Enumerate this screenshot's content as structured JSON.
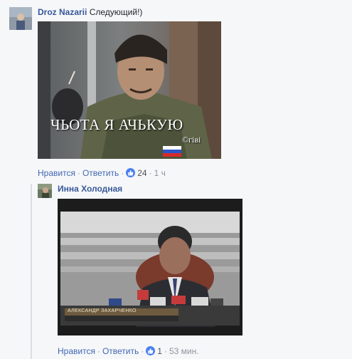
{
  "comment1": {
    "author": "Droz Nazarii",
    "text": "Следующий!)",
    "image_caption": "ЧЬОТА Я АЧЬКУЮ",
    "image_signature": "©гіві",
    "actions": {
      "like": "Нравится",
      "reply": "Ответить",
      "reactions_count": "24",
      "time": "1 ч"
    }
  },
  "comment2": {
    "author": "Инна Холодная",
    "image_tv_caption": "АЛЕКСАНДР ЗАХАРЧЕНКО",
    "actions": {
      "like": "Нравится",
      "reply": "Ответить",
      "reactions_count": "1",
      "time": "53 мин."
    }
  },
  "separator": "·",
  "colors": {
    "link": "#4267b2",
    "author": "#365899",
    "meta": "#90949c",
    "background": "#f6f7f9"
  },
  "icons": [
    "like-reaction-icon"
  ]
}
